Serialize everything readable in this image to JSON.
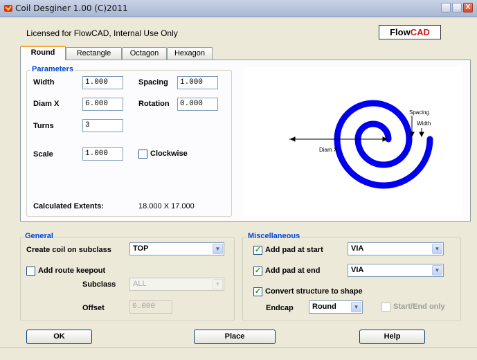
{
  "window": {
    "title": "Coil Desginer 1.00 (C)2011",
    "minimize_glyph": "_",
    "maximize_glyph": "□",
    "close_glyph": "X"
  },
  "license_text": "Licensed for FlowCAD, Internal Use Only",
  "logo": {
    "part1": "Flow",
    "part2": "CAD",
    "accent_color": "#d01818"
  },
  "tabs": [
    {
      "label": "Round",
      "active": true
    },
    {
      "label": "Rectangle",
      "active": false
    },
    {
      "label": "Octagon",
      "active": false
    },
    {
      "label": "Hexagon",
      "active": false
    }
  ],
  "parameters": {
    "title": "Parameters",
    "width_label": "Width",
    "width_value": "1.000",
    "spacing_label": "Spacing",
    "spacing_value": "1.000",
    "diamx_label": "Diam X",
    "diamx_value": "6.000",
    "rotation_label": "Rotation",
    "rotation_value": "0.000",
    "turns_label": "Turns",
    "turns_value": "3",
    "scale_label": "Scale",
    "scale_value": "1.000",
    "clockwise_label": "Clockwise",
    "clockwise_checked": false,
    "extents_label": "Calculated Extents:",
    "extents_value": "18.000 X 17.000"
  },
  "preview": {
    "coil_color": "#0000ee",
    "diam_label": "Diam X",
    "spacing_label": "Spacing",
    "width_label": "Width"
  },
  "general": {
    "title": "General",
    "subclass_label": "Create coil on subclass",
    "subclass_value": "TOP",
    "route_keepout_label": "Add route keepout",
    "route_keepout_checked": false,
    "keepout_subclass_label": "Subclass",
    "keepout_subclass_value": "ALL",
    "offset_label": "Offset",
    "offset_value": "0.000"
  },
  "misc": {
    "title": "Miscellaneous",
    "pad_start_label": "Add pad at start",
    "pad_start_checked": true,
    "pad_start_value": "VIA",
    "pad_end_label": "Add pad at end",
    "pad_end_checked": true,
    "pad_end_value": "VIA",
    "convert_label": "Convert structure to shape",
    "convert_checked": true,
    "endcap_label": "Endcap",
    "endcap_value": "Round",
    "startend_label": "Start/End only",
    "startend_checked": false
  },
  "buttons": {
    "ok": "OK",
    "place": "Place",
    "help": "Help"
  },
  "check_glyph": "✓",
  "drop_glyph": "▼"
}
